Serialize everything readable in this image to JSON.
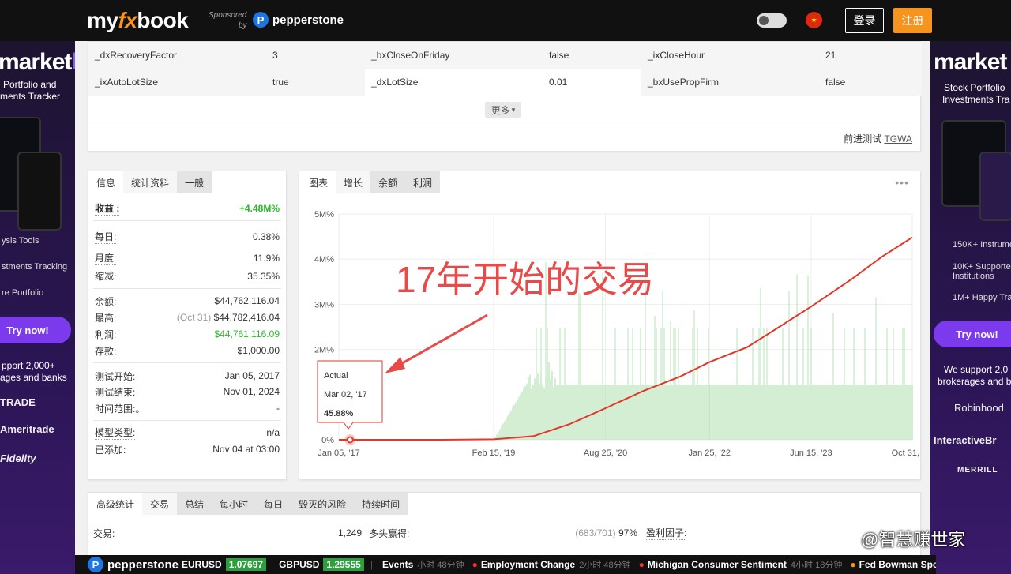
{
  "header": {
    "logo_my": "my",
    "logo_fx": "fx",
    "logo_book": "book",
    "sponsored_line1": "Sponsored",
    "sponsored_line2": "by",
    "sponsor_name": "pepperstone",
    "login_label": "登录",
    "register_label": "注册"
  },
  "ad_left": {
    "brand_a": "market",
    "brand_b": "log",
    "sub1": "Portfolio and",
    "sub2": "ments Tracker",
    "feature1": "ysis Tools",
    "feature2": "stments Tracking",
    "feature3": "re Portfolio",
    "try": "Try now!",
    "support1": "pport 2,000+",
    "support2": "ages and banks",
    "broker1": "TRADE",
    "broker2": "Ameritrade",
    "broker3": "Fidelity"
  },
  "ad_right": {
    "brand": "market",
    "sub1": "Stock Portfolio",
    "sub2": "Investments Tra",
    "feature1": "150K+ Instrumen",
    "feature2a": "10K+ Supported",
    "feature2b": "Institutions",
    "feature3": "1M+ Happy Trac",
    "try": "Try now!",
    "support1": "We support 2,0",
    "support2": "brokerages and b",
    "broker1": "Robinhood",
    "broker2": "InteractiveBr",
    "broker3": "MERRILL"
  },
  "params": {
    "rows": [
      [
        "_dxRecoveryFactor",
        "3",
        "_bxCloseOnFriday",
        "false",
        "_ixCloseHour",
        "21"
      ],
      [
        "_ixAutoLotSize",
        "true",
        "_dxLotSize",
        "0.01",
        "_bxUsePropFirm",
        "false"
      ]
    ],
    "more_label": "更多",
    "forward_label": "前进测试",
    "forward_link": "TGWA"
  },
  "stats": {
    "tabs": [
      "信息",
      "统计资料",
      "一般"
    ],
    "gain_label": "收益 :",
    "gain_value": "+4.48M%",
    "daily_label": "每日:",
    "daily_value": "0.38%",
    "monthly_label": "月度:",
    "monthly_value": "11.9%",
    "drawdown_label": "缩减:",
    "drawdown_value": "35.35%",
    "balance_label": "余额:",
    "balance_value": "$44,762,116.04",
    "highest_label": "最高:",
    "highest_date": "(Oct 31)",
    "highest_value": "$44,782,416.04",
    "profit_label": "利润:",
    "profit_value": "$44,761,116.09",
    "deposits_label": "存款:",
    "deposits_value": "$1,000.00",
    "test_start_label": "测试开始:",
    "test_start_value": "Jan 05, 2017",
    "test_end_label": "测试结束:",
    "test_end_value": "Nov 01, 2024",
    "timeframe_label": "时间范围:。",
    "timeframe_value": "-",
    "model_label": "模型类型:",
    "model_value": "n/a",
    "added_label": "已添加:",
    "added_value": "Nov 04 at 03:00"
  },
  "chart_tabs": [
    "图表",
    "增长",
    "余额",
    "利润"
  ],
  "annotation": "17年开始的交易",
  "tooltip": {
    "title": "Actual",
    "date": "Mar 02, '17",
    "value": "45.88%"
  },
  "chart_data": {
    "type": "line",
    "y_ticks": [
      "5M%",
      "4M%",
      "3M%",
      "2M%",
      "0%"
    ],
    "x_ticks": [
      "Jan 05, '17",
      "Feb 15, '19",
      "Aug 25, '20",
      "Jan 25, '22",
      "Jun 15, '23",
      "Oct 31, '24"
    ],
    "ylim": [
      0,
      5000000
    ],
    "series": [
      {
        "type": "line",
        "color": "#e0392b",
        "x": [
          "2017-01-05",
          "2018-06-01",
          "2019-02-15",
          "2019-09-01",
          "2020-03-01",
          "2020-08-25",
          "2021-03-01",
          "2021-09-01",
          "2022-01-25",
          "2022-08-01",
          "2023-01-01",
          "2023-06-15",
          "2024-01-01",
          "2024-06-01",
          "2024-10-31"
        ],
        "values": [
          0,
          0,
          10000,
          80000,
          350000,
          700000,
          1080000,
          1400000,
          1720000,
          2050000,
          2480000,
          2950000,
          3550000,
          4050000,
          4480000
        ]
      },
      {
        "type": "bar",
        "color": "#a8dca8",
        "levels_note": "monthly growth bars",
        "values": [
          0
        ]
      }
    ],
    "grid": true
  },
  "bottom": {
    "tabs": [
      "高级统计",
      "交易",
      "总结",
      "每小时",
      "每日",
      "毁灭的风险",
      "持续时间"
    ],
    "trades_label": "交易:",
    "trades_value": "1,249",
    "longs_label": "多头赢得:",
    "longs_value_a": "(683/701)",
    "longs_value_b": "97%",
    "pf_label": "盈利因子:"
  },
  "ticker": {
    "brand": "pepperstone",
    "sym1": "EURUSD",
    "val1": "1.07697",
    "sym2": "GBPUSD",
    "val2": "1.29555",
    "events_label": "Events",
    "ev0_time": "小时 48分钟",
    "ev1": "Employment Change",
    "ev1_time": "2小时 48分钟",
    "ev2": "Michigan Consumer Sentiment",
    "ev2_time": "4小时 18分钟",
    "ev3": "Fed Bowman Spe"
  },
  "watermark": "@智慧赚世家"
}
